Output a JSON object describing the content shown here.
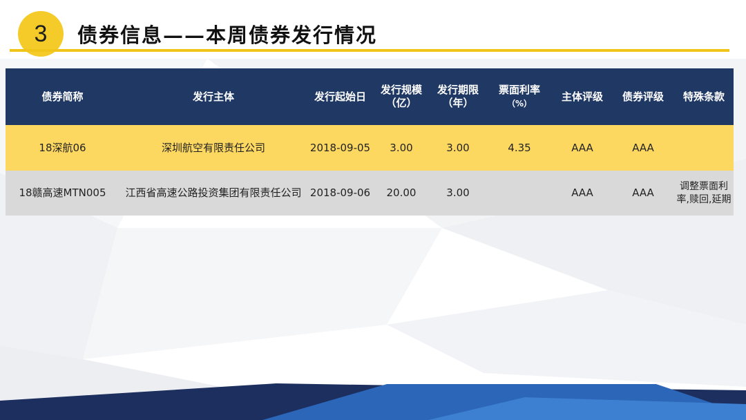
{
  "header": {
    "section_number": "3",
    "title": "债券信息——本周债券发行情况"
  },
  "table": {
    "columns": [
      {
        "line1": "债券简称",
        "line2": ""
      },
      {
        "line1": "发行主体",
        "line2": ""
      },
      {
        "line1": "发行起始日",
        "line2": ""
      },
      {
        "line1": "发行规模",
        "line2": "（亿）"
      },
      {
        "line1": "发行期限",
        "line2": "（年）"
      },
      {
        "line1": "票面利率",
        "line2": "（%）"
      },
      {
        "line1": "主体评级",
        "line2": ""
      },
      {
        "line1": "债券评级",
        "line2": ""
      },
      {
        "line1": "特殊条款",
        "line2": ""
      }
    ],
    "rows": [
      {
        "short_name": "18深航06",
        "issuer": "深圳航空有限责任公司",
        "start_date": "2018-09-05",
        "scale": "3.00",
        "term": "3.00",
        "coupon": "4.35",
        "entity_rating": "AAA",
        "bond_rating": "AAA",
        "special_line1": "",
        "special_line2": ""
      },
      {
        "short_name": "18赣高速MTN005",
        "issuer": "江西省高速公路投资集团有限责任公司",
        "start_date": "2018-09-06",
        "scale": "20.00",
        "term": "3.00",
        "coupon": "",
        "entity_rating": "AAA",
        "bond_rating": "AAA",
        "special_line1": "调整票面利",
        "special_line2": "率,赎回,延期"
      }
    ]
  },
  "colors": {
    "accent_yellow": "#f5cb2a",
    "header_navy": "#1f3864",
    "row_highlight": "#fdd860",
    "row_alt": "#d9d9d9"
  }
}
